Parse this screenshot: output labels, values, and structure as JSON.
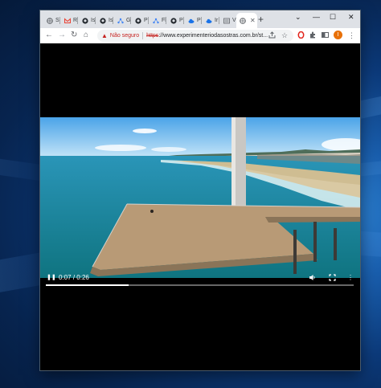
{
  "browser": {
    "tabs": [
      {
        "label": "Sí",
        "icon": "globe-icon",
        "color": "#5f6368"
      },
      {
        "label": "R",
        "icon": "gmail-icon",
        "color": "#ea4335"
      },
      {
        "label": "Is",
        "icon": "github-icon",
        "color": "#24292f"
      },
      {
        "label": "Is",
        "icon": "github-icon",
        "color": "#24292f"
      },
      {
        "label": "G",
        "icon": "graph-icon",
        "color": "#4285f4"
      },
      {
        "label": "P",
        "icon": "github-icon",
        "color": "#24292f"
      },
      {
        "label": "Fl",
        "icon": "graph-icon",
        "color": "#4285f4"
      },
      {
        "label": "P",
        "icon": "github-icon",
        "color": "#24292f"
      },
      {
        "label": "P",
        "icon": "cloud-icon",
        "color": "#1a73e8"
      },
      {
        "label": "Ir",
        "icon": "cloud-icon",
        "color": "#1a73e8"
      },
      {
        "label": "V",
        "icon": "list-icon",
        "color": "#5f6368"
      }
    ],
    "active_tab": {
      "label": "",
      "icon": "globe-icon",
      "close": "✕"
    },
    "new_tab": "+",
    "window_controls": {
      "dropdown": "⌄",
      "minimize": "—",
      "maximize": "☐",
      "close": "✕"
    },
    "nav": {
      "back": "←",
      "forward": "→",
      "reload": "↻",
      "home": "⌂"
    },
    "address": {
      "warning_label": "Não seguro",
      "scheme": "https",
      "url_rest": "://www.experimenteriodasostras.com.br/st..."
    },
    "toolbar_icons": [
      "share-icon",
      "star-icon",
      "opera-extension-icon",
      "extensions-icon",
      "tab-search-icon"
    ],
    "profile_initial": "I",
    "menu": "⋮"
  },
  "video": {
    "current_time": "0:07",
    "duration": "0:26",
    "progress": 0.27,
    "pause_symbol": "❚❚",
    "colors": {
      "sky": "#6fb6ea",
      "sea": "#1f8fa0",
      "pier": "#b89a76"
    }
  }
}
